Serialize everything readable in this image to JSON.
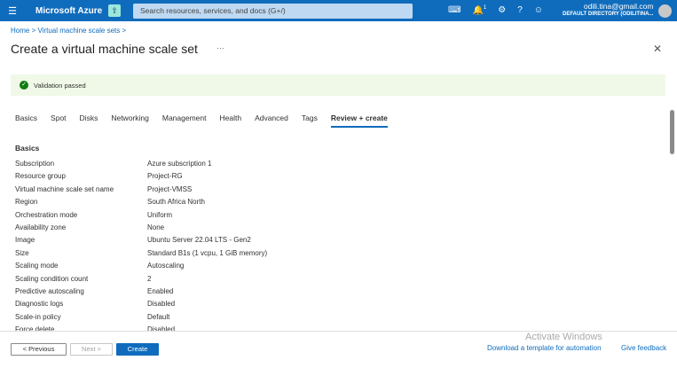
{
  "topbar": {
    "brand": "Microsoft Azure",
    "search_placeholder": "Search resources, services, and docs (G+/)",
    "notification_count": "1",
    "account_email": "odili.tina@gmail.com",
    "account_directory": "DEFAULT DIRECTORY (ODILITINA..."
  },
  "breadcrumb": [
    "Home",
    "Virtual machine scale sets"
  ],
  "page": {
    "title": "Create a virtual machine scale set",
    "more": "···",
    "close": "✕"
  },
  "validation": "Validation passed",
  "tabs": [
    "Basics",
    "Spot",
    "Disks",
    "Networking",
    "Management",
    "Health",
    "Advanced",
    "Tags",
    "Review + create"
  ],
  "active_tab": "Review + create",
  "section": "Basics",
  "rows": [
    [
      "Subscription",
      "Azure subscription 1"
    ],
    [
      "Resource group",
      "Project-RG"
    ],
    [
      "Virtual machine scale set name",
      "Project-VMSS"
    ],
    [
      "Region",
      "South Africa North"
    ],
    [
      "Orchestration mode",
      "Uniform"
    ],
    [
      "Availability zone",
      "None"
    ],
    [
      "Image",
      "Ubuntu Server 22.04 LTS - Gen2"
    ],
    [
      "Size",
      "Standard B1s (1 vcpu, 1 GiB memory)"
    ],
    [
      "Scaling mode",
      "Autoscaling"
    ],
    [
      "Scaling condition count",
      "2"
    ],
    [
      "Predictive autoscaling",
      "Enabled"
    ],
    [
      "Diagnostic logs",
      "Disabled"
    ],
    [
      "Scale-in policy",
      "Default"
    ],
    [
      "Force delete",
      "Disabled"
    ]
  ],
  "footer": {
    "previous": "< Previous",
    "next": "Next >",
    "create": "Create",
    "download": "Download a template for automation",
    "feedback": "Give feedback",
    "watermark": "Activate Windows"
  }
}
